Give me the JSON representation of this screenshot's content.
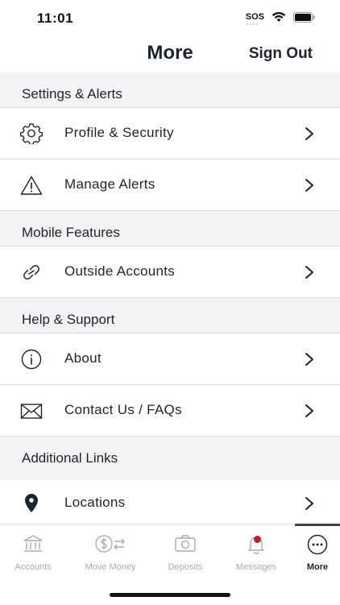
{
  "status_bar": {
    "time": "11:01",
    "sos": "SOS"
  },
  "header": {
    "title": "More",
    "sign_out": "Sign Out"
  },
  "sections": {
    "settings": {
      "title": "Settings & Alerts"
    },
    "mobile": {
      "title": "Mobile Features"
    },
    "help": {
      "title": "Help & Support"
    },
    "additional": {
      "title": "Additional Links"
    }
  },
  "menu": {
    "profile": {
      "label": "Profile & Security",
      "icon": "gear-icon"
    },
    "alerts": {
      "label": "Manage Alerts",
      "icon": "warning-icon"
    },
    "outside": {
      "label": "Outside Accounts",
      "icon": "link-icon"
    },
    "about": {
      "label": "About",
      "icon": "info-icon"
    },
    "contact": {
      "label": "Contact Us / FAQs",
      "icon": "envelope-icon"
    },
    "locations": {
      "label": "Locations",
      "icon": "map-pin-icon"
    }
  },
  "tabs": {
    "accounts": {
      "label": "Accounts",
      "icon": "bank-icon"
    },
    "move_money": {
      "label": "Move Money",
      "icon": "transfer-icon"
    },
    "deposits": {
      "label": "Deposits",
      "icon": "camera-icon"
    },
    "messages": {
      "label": "Messages",
      "icon": "bell-icon"
    },
    "more": {
      "label": "More",
      "icon": "more-dots-icon",
      "active": true
    }
  },
  "colors": {
    "text": "#1c2430",
    "section_bg": "#f2f3f5",
    "inactive_tab": "#a7abb3",
    "badge": "#c0202e"
  }
}
